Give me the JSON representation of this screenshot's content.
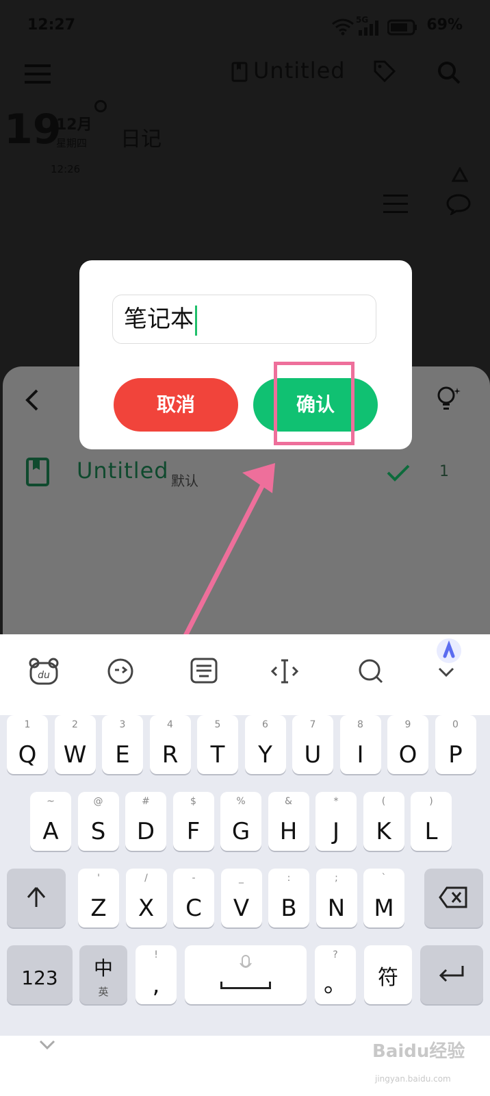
{
  "status": {
    "time": "12:27",
    "battery": "69%",
    "network": "5G"
  },
  "header": {
    "notebook_title": "Untitled"
  },
  "date": {
    "day": "19",
    "month": "12月",
    "weekday": "星期四",
    "time_small": "12:26",
    "section": "日记"
  },
  "sheet": {
    "item_title": "Untitled",
    "item_badge": "默认",
    "item_count": "1"
  },
  "dialog": {
    "input_value": "笔记本",
    "cancel_label": "取消",
    "ok_label": "确认"
  },
  "keyboard": {
    "row1": [
      [
        "1",
        "Q"
      ],
      [
        "2",
        "W"
      ],
      [
        "3",
        "E"
      ],
      [
        "4",
        "R"
      ],
      [
        "5",
        "T"
      ],
      [
        "6",
        "Y"
      ],
      [
        "7",
        "U"
      ],
      [
        "8",
        "I"
      ],
      [
        "9",
        "O"
      ],
      [
        "0",
        "P"
      ]
    ],
    "row2": [
      [
        "~",
        "A"
      ],
      [
        "@",
        "S"
      ],
      [
        "#",
        "D"
      ],
      [
        "$",
        "F"
      ],
      [
        "%",
        "G"
      ],
      [
        "&",
        "H"
      ],
      [
        "*",
        "J"
      ],
      [
        "(",
        "K"
      ],
      [
        ")",
        "L"
      ]
    ],
    "row3": [
      [
        "'",
        "Z"
      ],
      [
        "/",
        "X"
      ],
      [
        "-",
        "C"
      ],
      [
        "_",
        "V"
      ],
      [
        ":",
        "B"
      ],
      [
        ";",
        "N"
      ],
      [
        "`",
        "M"
      ]
    ],
    "num_label": "123",
    "lang_main": "中",
    "lang_sub": "英",
    "comma_sub": "!",
    "comma_main": ",",
    "period_sub": "?",
    "period_main": "。",
    "symbol_label": "符"
  },
  "watermark": {
    "text": "Baidu经验",
    "sub": "jingyan.baidu.com"
  }
}
